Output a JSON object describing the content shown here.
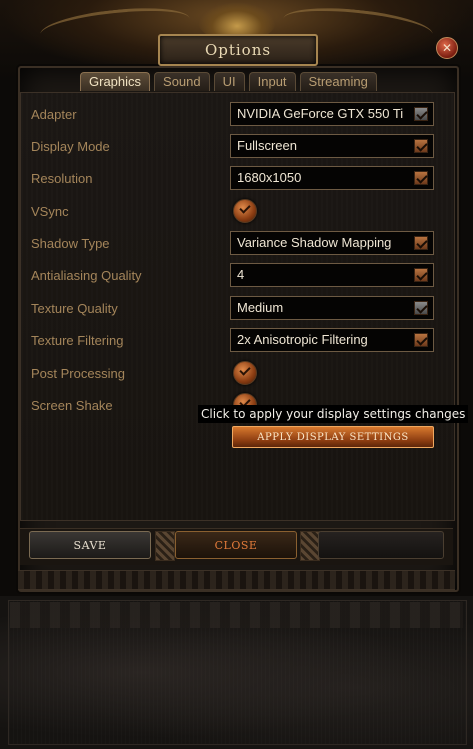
{
  "window": {
    "title": "Options",
    "close_icon": "close-icon"
  },
  "tabs": [
    {
      "label": "Graphics",
      "active": true
    },
    {
      "label": "Sound",
      "active": false
    },
    {
      "label": "UI",
      "active": false
    },
    {
      "label": "Input",
      "active": false
    },
    {
      "label": "Streaming",
      "active": false
    }
  ],
  "settings": {
    "adapter": {
      "label": "Adapter",
      "value": "NVIDIA GeForce GTX 550 Ti",
      "enabled": false
    },
    "display_mode": {
      "label": "Display Mode",
      "value": "Fullscreen"
    },
    "resolution": {
      "label": "Resolution",
      "value": "1680x1050"
    },
    "vsync": {
      "label": "VSync",
      "checked": true
    },
    "shadow_type": {
      "label": "Shadow Type",
      "value": "Variance Shadow Mapping"
    },
    "antialiasing_quality": {
      "label": "Antialiasing Quality",
      "value": "4"
    },
    "texture_quality": {
      "label": "Texture Quality",
      "value": "Medium",
      "enabled": false
    },
    "texture_filtering": {
      "label": "Texture Filtering",
      "value": "2x Anisotropic Filtering"
    },
    "post_processing": {
      "label": "Post Processing",
      "checked": true
    },
    "screen_shake": {
      "label": "Screen Shake",
      "checked": true
    }
  },
  "tooltip": "Click to apply your display settings changes",
  "apply_button": "APPLY DISPLAY SETTINGS",
  "footer": {
    "save_label": "SAVE",
    "close_label": "CLOSE"
  },
  "colors": {
    "accent": "#d8792e",
    "label": "#a4855a",
    "field_bg": "#050403"
  }
}
